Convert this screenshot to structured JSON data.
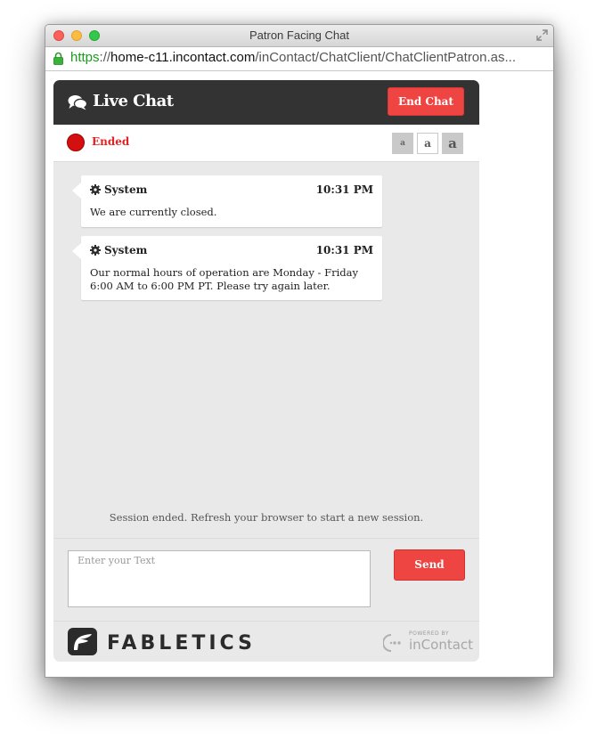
{
  "window": {
    "title": "Patron Facing Chat",
    "url_scheme": "https",
    "url_separator": "://",
    "url_host": "home-c11.incontact.com",
    "url_path": "/inContact/ChatClient/ChatClientPatron.as..."
  },
  "chat": {
    "title": "Live Chat",
    "end_label": "End Chat",
    "status": "Ended",
    "status_color": "#d30f0f",
    "font_sizes": [
      "a",
      "a",
      "a"
    ],
    "messages": [
      {
        "sender": "System",
        "time": "10:31 PM",
        "text": "We are currently closed."
      },
      {
        "sender": "System",
        "time": "10:31 PM",
        "text": "Our normal hours of operation are Monday - Friday 6:00 AM to 6:00 PM PT. Please try again later."
      }
    ],
    "session_note": "Session ended. Refresh your browser to start a new session.",
    "input_placeholder": "Enter your Text",
    "send_label": "Send"
  },
  "footer": {
    "brand": "FABLETICS",
    "powered_by": "POWERED BY",
    "powered_name": "inContact"
  },
  "colors": {
    "accent": "#ee4442",
    "header": "#333333",
    "panel": "#e9e9e9"
  },
  "icons": [
    "lock-icon",
    "fullscreen-icon",
    "chat-bubbles-icon",
    "gear-icon",
    "fabletics-logo-icon",
    "incontact-logo-icon"
  ]
}
